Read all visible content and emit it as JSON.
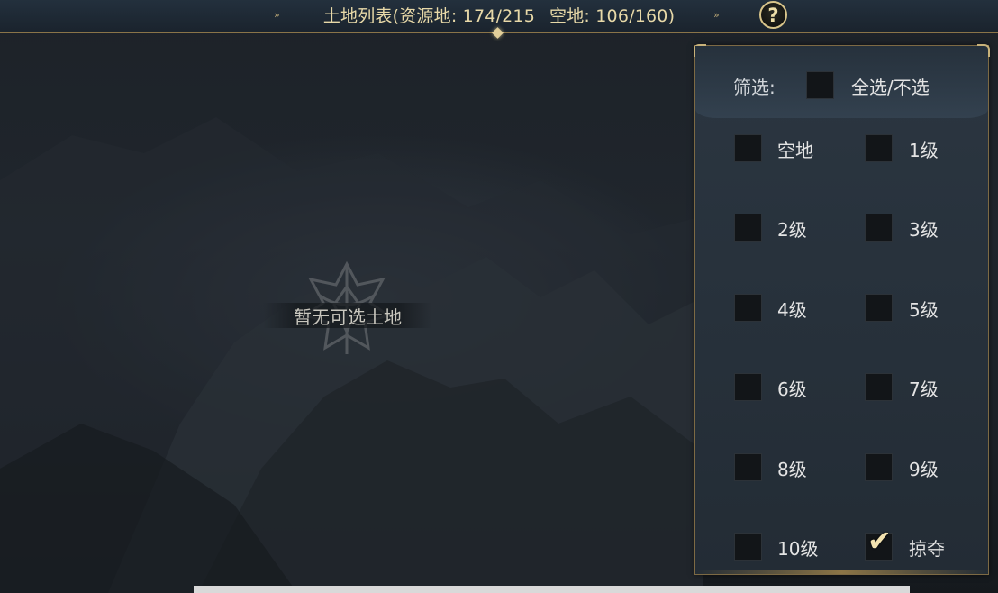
{
  "header": {
    "title_main": "土地列表(资源地: 174/215",
    "title_secondary": "空地: 106/160)",
    "ornament": "»",
    "help_label": "?"
  },
  "empty_state": {
    "message": "暂无可选土地"
  },
  "filter": {
    "label": "筛选:",
    "select_all_label": "全选/不选",
    "select_all_checked": false,
    "options": [
      {
        "label": "空地",
        "checked": false
      },
      {
        "label": "1级",
        "checked": false
      },
      {
        "label": "2级",
        "checked": false
      },
      {
        "label": "3级",
        "checked": false
      },
      {
        "label": "4级",
        "checked": false
      },
      {
        "label": "5级",
        "checked": false
      },
      {
        "label": "6级",
        "checked": false
      },
      {
        "label": "7级",
        "checked": false
      },
      {
        "label": "8级",
        "checked": false
      },
      {
        "label": "9级",
        "checked": false
      },
      {
        "label": "10级",
        "checked": false
      },
      {
        "label": "掠夺",
        "checked": true
      }
    ],
    "check_glyph": "✔"
  },
  "colors": {
    "accent_gold": "#e8d9a8",
    "border_gold": "#8a7448",
    "panel_bg": "#2b3641"
  }
}
